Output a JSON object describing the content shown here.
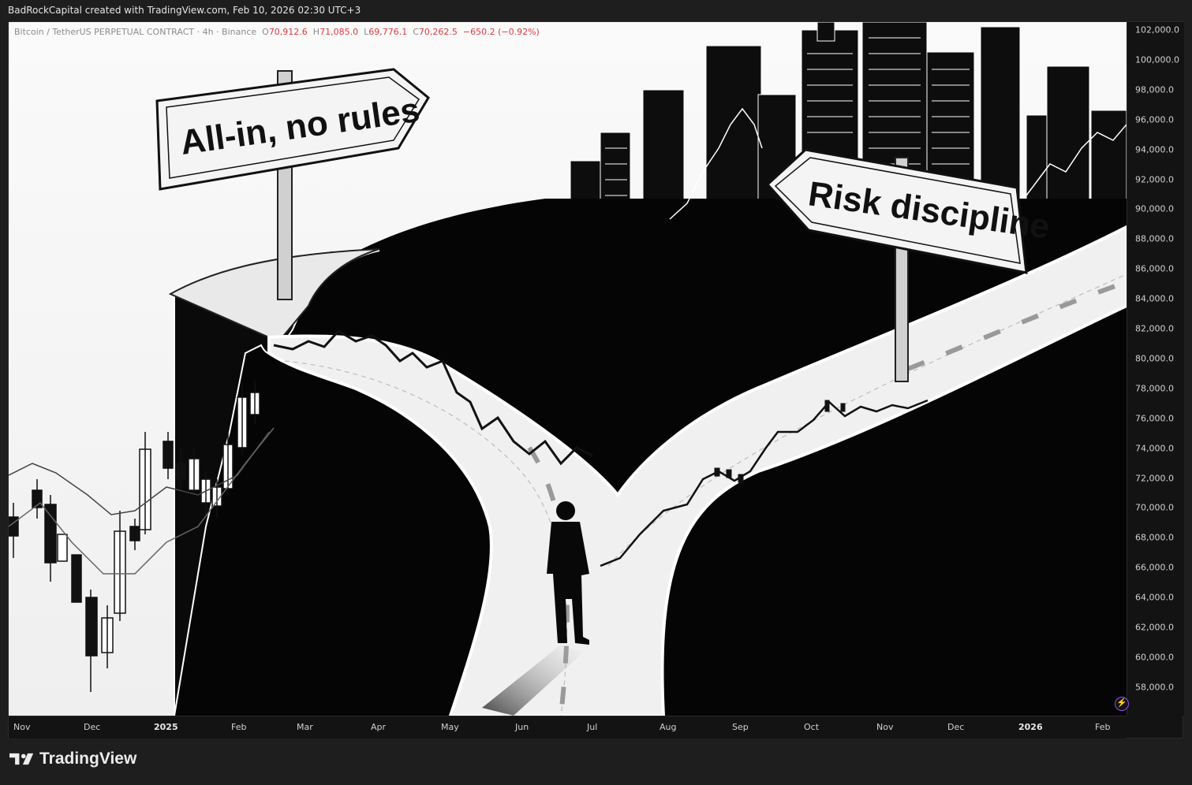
{
  "topbar": {
    "text": "BadRockCapital created with TradingView.com, Feb 10, 2026 02:30 UTC+3"
  },
  "legend": {
    "symbol": "Bitcoin / TetherUS PERPETUAL CONTRACT · 4h · Binance",
    "open_label": "O",
    "open": "70,912.6",
    "high_label": "H",
    "high": "71,085.0",
    "low_label": "L",
    "low": "69,776.1",
    "close_label": "C",
    "close": "70,262.5",
    "change": "−650.2 (−0.92%)",
    "change_color": "#e0393e"
  },
  "signs": {
    "left": "All-in, no rules",
    "right": "Risk discipline"
  },
  "price_axis": [
    "102,000.0",
    "100,000.0",
    "98,000.0",
    "96,000.0",
    "94,000.0",
    "92,000.0",
    "90,000.0",
    "88,000.0",
    "86,000.0",
    "84,000.0",
    "82,000.0",
    "80,000.0",
    "78,000.0",
    "76,000.0",
    "74,000.0",
    "72,000.0",
    "70,000.0",
    "68,000.0",
    "66,000.0",
    "64,000.0",
    "62,000.0",
    "60,000.0",
    "58,000.0"
  ],
  "time_axis": [
    {
      "label": "Nov",
      "bold": false
    },
    {
      "label": "Dec",
      "bold": false
    },
    {
      "label": "2025",
      "bold": true
    },
    {
      "label": "Feb",
      "bold": false
    },
    {
      "label": "Mar",
      "bold": false
    },
    {
      "label": "Apr",
      "bold": false
    },
    {
      "label": "May",
      "bold": false
    },
    {
      "label": "Jun",
      "bold": false
    },
    {
      "label": "Jul",
      "bold": false
    },
    {
      "label": "Aug",
      "bold": false
    },
    {
      "label": "Sep",
      "bold": false
    },
    {
      "label": "Oct",
      "bold": false
    },
    {
      "label": "Nov",
      "bold": false
    },
    {
      "label": "Dec",
      "bold": false
    },
    {
      "label": "2026",
      "bold": true
    },
    {
      "label": "Feb",
      "bold": false
    }
  ],
  "brand": {
    "name": "TradingView",
    "logo_icon": "tradingview-logo-icon"
  },
  "alert_icon": "lightning-icon",
  "colors": {
    "background": "#1e1e1e",
    "panel": "#131313",
    "down": "#e0393e",
    "alert": "#8e4cff"
  }
}
